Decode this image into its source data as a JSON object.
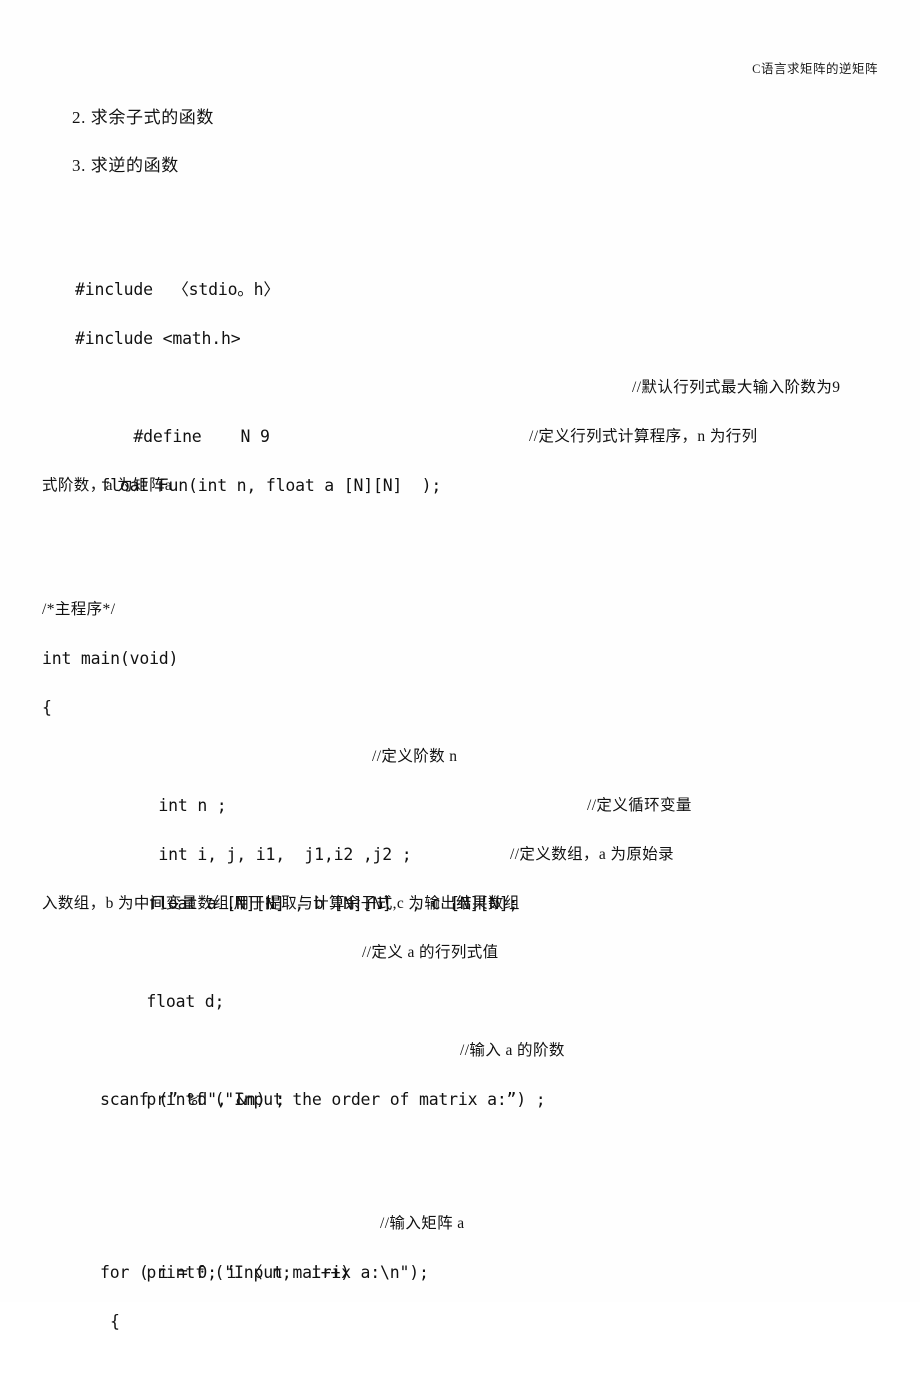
{
  "document": {
    "running_header": "C语言求矩阵的逆矩阵",
    "page_background": "#fefefe",
    "text_color": "#111111"
  },
  "outline": [
    {
      "id": "item-2",
      "text": "2. 求余子式的函数"
    },
    {
      "id": "item-3",
      "text": "3. 求逆的函数"
    }
  ],
  "code": {
    "include_stdio": "#include  〈stdio。h〉",
    "include_math": "#include <math.h>",
    "define_n": "#define    N 9",
    "define_n_comment": "//默认行列式最大输入阶数为9",
    "fun_proto": "float Fun(int n, float a [N][N]  );",
    "fun_proto_comment": "//定义行列式计算程序，n 为行列",
    "fun_proto_comment_wrap": "式阶数，a 为矩阵a",
    "main_block_comment": "/*主程序*/",
    "main_signature": "int main(void)",
    "main_open_brace": "{",
    "decl_n": "int n ;",
    "decl_n_comment": "//定义阶数 n",
    "decl_loop_vars": "int i, j, i1,  j1,i2 ,j2 ;",
    "decl_loop_vars_comment": "//定义循环变量",
    "decl_arrays": "float a [N][N] , b [N][N]  , c [N][N];",
    "decl_arrays_comment": "//定义数组，a 为原始录",
    "decl_arrays_comment_wrap": "入数组，b 为中间变量数组,用于提取与计算余子式,c 为输出结果数组",
    "decl_d": "float d;",
    "decl_d_comment": "//定义 a 的行列式值",
    "printf_order": "printf (\"Input the order of matrix a:”) ;",
    "printf_order_comment": "//输入 a 的阶数",
    "scanf_order": "scanf (” %d\", &n) ;",
    "printf_matrix": "printf (\"Input matrix a:\\n\");",
    "printf_matrix_comment": "//输入矩阵 a",
    "for_loop": "for ( i = 0; i 〈 n;  i++)",
    "for_open_brace": "{"
  }
}
